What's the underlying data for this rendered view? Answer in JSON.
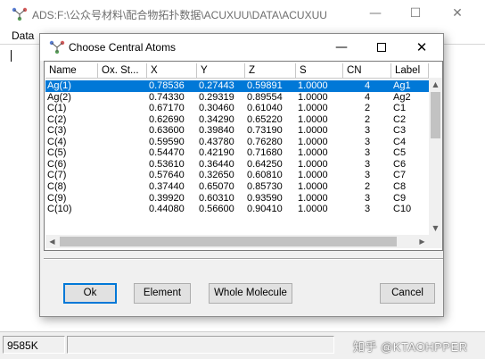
{
  "app": {
    "title": "ADS:F:\\公众号材料\\配合物拓扑数据\\ACUXUU\\DATA\\ACUXUU",
    "icon": "ads-app-icon",
    "minimize_glyph": "—",
    "maximize_glyph": "☐",
    "close_glyph": "✕",
    "menu": [
      "Data"
    ],
    "status_left": "9585K",
    "watermark": "知乎 @KTAOHPPER"
  },
  "dialog": {
    "title": "Choose Central Atoms",
    "icon": "ads-app-icon",
    "minimize_glyph": "—",
    "close_glyph": "✕",
    "columns": [
      "Name",
      "Ox. St...",
      "X",
      "Y",
      "Z",
      "S",
      "CN",
      "Label"
    ],
    "rows": [
      [
        "Ag(1)",
        "",
        "0.78536",
        "0.27443",
        "0.59891",
        "1.0000",
        "4",
        "Ag1"
      ],
      [
        "Ag(2)",
        "",
        "0.74330",
        "0.29319",
        "0.89554",
        "1.0000",
        "4",
        "Ag2"
      ],
      [
        "C(1)",
        "",
        "0.67170",
        "0.30460",
        "0.61040",
        "1.0000",
        "2",
        "C1"
      ],
      [
        "C(2)",
        "",
        "0.62690",
        "0.34290",
        "0.65220",
        "1.0000",
        "2",
        "C2"
      ],
      [
        "C(3)",
        "",
        "0.63600",
        "0.39840",
        "0.73190",
        "1.0000",
        "3",
        "C3"
      ],
      [
        "C(4)",
        "",
        "0.59590",
        "0.43780",
        "0.76280",
        "1.0000",
        "3",
        "C4"
      ],
      [
        "C(5)",
        "",
        "0.54470",
        "0.42190",
        "0.71680",
        "1.0000",
        "3",
        "C5"
      ],
      [
        "C(6)",
        "",
        "0.53610",
        "0.36440",
        "0.64250",
        "1.0000",
        "3",
        "C6"
      ],
      [
        "C(7)",
        "",
        "0.57640",
        "0.32650",
        "0.60810",
        "1.0000",
        "3",
        "C7"
      ],
      [
        "C(8)",
        "",
        "0.37440",
        "0.65070",
        "0.85730",
        "1.0000",
        "2",
        "C8"
      ],
      [
        "C(9)",
        "",
        "0.39920",
        "0.60310",
        "0.93590",
        "1.0000",
        "3",
        "C9"
      ],
      [
        "C(10)",
        "",
        "0.44080",
        "0.56600",
        "0.90410",
        "1.0000",
        "3",
        "C10"
      ]
    ],
    "selected_row": 0,
    "scroll_up_glyph": "▲",
    "scroll_down_glyph": "▼",
    "scroll_left_glyph": "◀",
    "scroll_right_glyph": "▶",
    "buttons": {
      "ok": "Ok",
      "element": "Element",
      "whole_molecule": "Whole Molecule",
      "cancel": "Cancel"
    },
    "selection_color": "#0078d7"
  }
}
